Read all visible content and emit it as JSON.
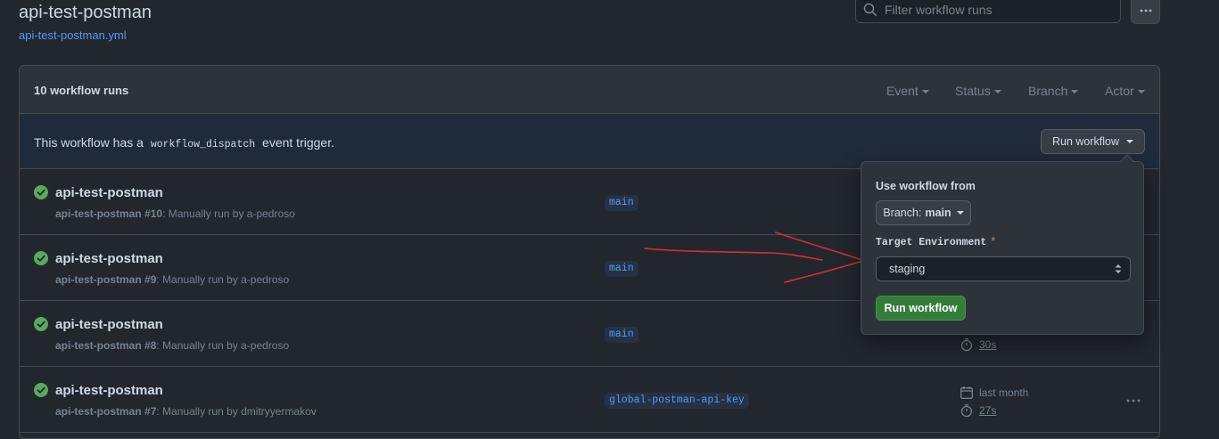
{
  "header": {
    "title": "api-test-postman",
    "file_link": "api-test-postman.yml",
    "filter_placeholder": "Filter workflow runs"
  },
  "panel": {
    "runs_count": "10 workflow runs",
    "filters": [
      "Event",
      "Status",
      "Branch",
      "Actor"
    ]
  },
  "dispatch": {
    "text_before": "This workflow has a",
    "code": "workflow_dispatch",
    "text_after": "event trigger.",
    "button_label": "Run workflow"
  },
  "dropdown": {
    "use_from_label": "Use workflow from",
    "branch_prefix": "Branch:",
    "branch_value": "main",
    "env_label": "Target Environment",
    "required_mark": "*",
    "env_value": "staging",
    "run_button": "Run workflow"
  },
  "runs": [
    {
      "title": "api-test-postman",
      "name": "api-test-postman",
      "number": "#10",
      "trigger": ": Manually run by a-pedroso",
      "branch": "main",
      "date": "",
      "duration": ""
    },
    {
      "title": "api-test-postman",
      "name": "api-test-postman",
      "number": "#9",
      "trigger": ": Manually run by a-pedroso",
      "branch": "main",
      "date": "",
      "duration": ""
    },
    {
      "title": "api-test-postman",
      "name": "api-test-postman",
      "number": "#8",
      "trigger": ": Manually run by a-pedroso",
      "branch": "main",
      "date": "",
      "duration": "30s"
    },
    {
      "title": "api-test-postman",
      "name": "api-test-postman",
      "number": "#7",
      "trigger": ": Manually run by dmitryyermakov",
      "branch": "global-postman-api-key",
      "date": "last month",
      "duration": "27s"
    }
  ],
  "colors": {
    "success": "#57ab5a",
    "link": "#539bf5",
    "annotation": "#e5534b"
  }
}
